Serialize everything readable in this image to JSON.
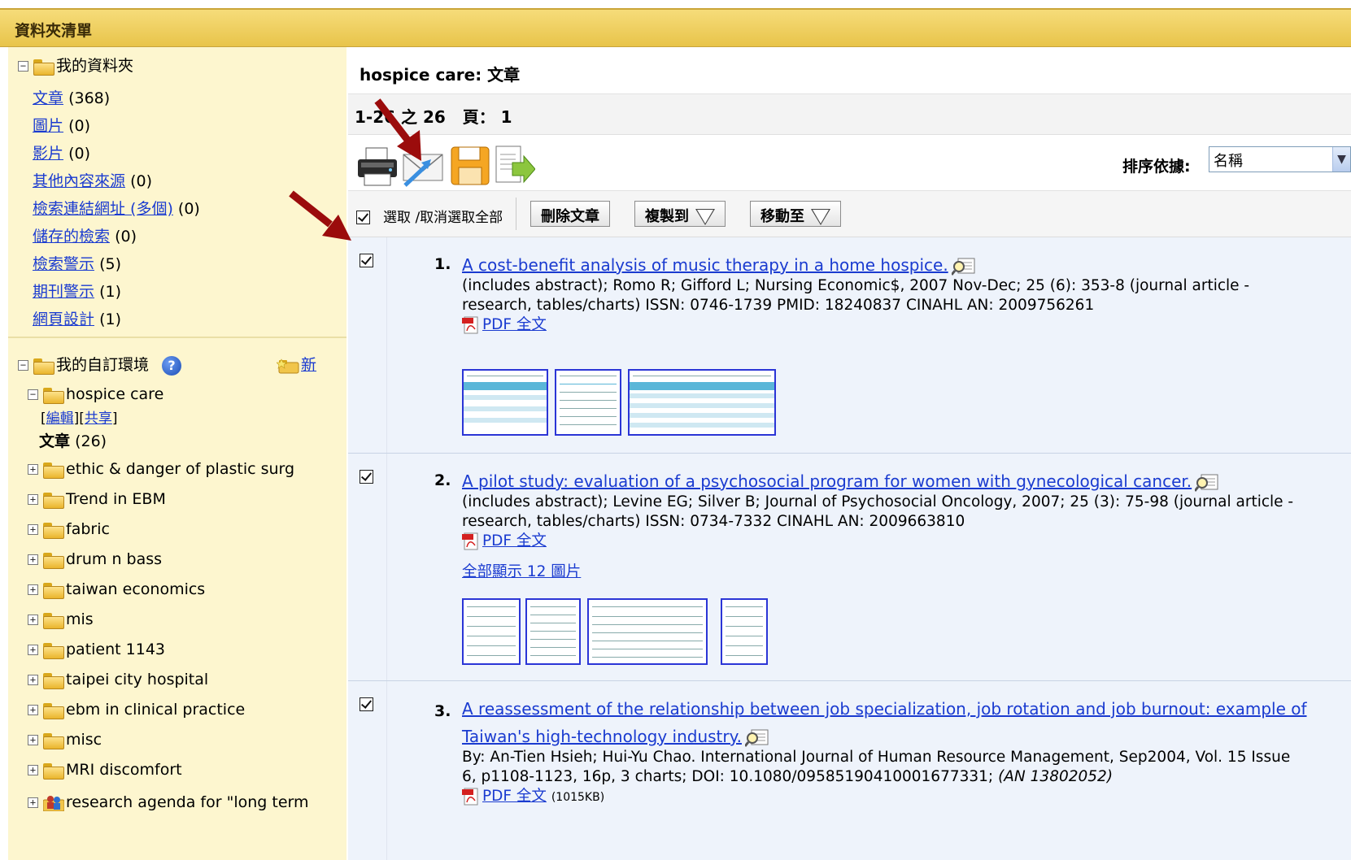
{
  "title_bar": {
    "title": "資料夾清單"
  },
  "sidebar": {
    "my_folder": {
      "label": "我的資料夾"
    },
    "items": [
      {
        "label": "文章",
        "count": "(368)"
      },
      {
        "label": "圖片",
        "count": "(0)"
      },
      {
        "label": "影片",
        "count": "(0)"
      },
      {
        "label": "其他內容來源",
        "count": "(0)"
      },
      {
        "label": "檢索連結網址 (多個)",
        "count": "(0)"
      },
      {
        "label": "儲存的檢索",
        "count": "(0)"
      },
      {
        "label": "檢索警示",
        "count": "(5)"
      },
      {
        "label": "期刊警示",
        "count": "(1)"
      },
      {
        "label": "網頁設計",
        "count": "(1)"
      }
    ],
    "custom": {
      "label": "我的自訂環境",
      "help": "?",
      "new_label": "新"
    },
    "current_folder": {
      "name": "hospice care",
      "edit": "編輯",
      "share": "共享",
      "articles_label": "文章",
      "articles_count": "(26)"
    },
    "folders": [
      "ethic & danger of plastic surg",
      "Trend in EBM",
      "fabric",
      "drum n bass",
      "taiwan economics",
      "mis",
      "patient 1143",
      "taipei city hospital",
      "ebm in clinical practice",
      "misc",
      "MRI discomfort"
    ],
    "last_folder": "research agenda for \"long term"
  },
  "main": {
    "header": "hospice care:  文章",
    "paging": "1-26 之 26   頁： 1",
    "sort_label": "排序依據:",
    "sort_value": "名稱",
    "select_all": "選取 /取消選取全部",
    "delete_btn": "刪除文章",
    "copy_btn": "複製到",
    "move_btn": "移動至"
  },
  "results": [
    {
      "num": "1.",
      "title": "A cost-benefit analysis of music therapy in a home hospice.",
      "line1": "(includes abstract); Romo R; Gifford L; Nursing Economic$, 2007 Nov-Dec; 25 (6): 353-8 (journal article -",
      "line2": "research, tables/charts) ISSN: 0746-1739 PMID: 18240837 CINAHL AN: 2009756261",
      "pdf": "PDF 全文"
    },
    {
      "num": "2.",
      "title": "A pilot study: evaluation of a psychosocial program for women with gynecological cancer.",
      "line1": "(includes abstract); Levine EG; Silver B; Journal of Psychosocial Oncology, 2007; 25 (3): 75-98 (journal article -",
      "line2": "research, tables/charts) ISSN: 0734-7332 CINAHL AN: 2009663810",
      "pdf": "PDF 全文",
      "show_all": "全部顯示 12 圖片"
    },
    {
      "num": "3.",
      "title_line1": "A reassessment of the relationship between job specialization, job rotation and job burnout: example of",
      "title_line2": "Taiwan's high-technology industry.",
      "line1": "By: An-Tien Hsieh; Hui-Yu Chao. International Journal of Human Resource Management, Sep2004, Vol. 15 Issue",
      "line2": "6, p1108-1123, 16p, 3 charts; DOI: 10.1080/09585190410001677331;",
      "an": "(AN 13802052)",
      "pdf": "PDF 全文",
      "size": "(1015KB)"
    }
  ],
  "colors": {
    "title_bar": "#e8c44a",
    "sidebar": "#fdf6cf",
    "link": "#1a3bd0",
    "result_bg": "#eef3fb",
    "arrow": "#9b0c0c"
  }
}
